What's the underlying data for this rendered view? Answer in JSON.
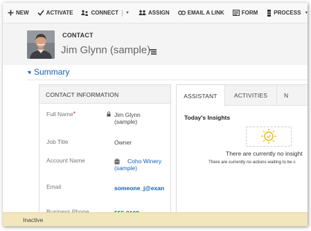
{
  "command_bar": {
    "new": "NEW",
    "activate": "ACTIVATE",
    "connect": "CONNECT",
    "assign": "ASSIGN",
    "email_link": "EMAIL A LINK",
    "form": "FORM",
    "process": "PROCESS"
  },
  "header": {
    "entity": "CONTACT",
    "record_name": "Jim Glynn (sample)"
  },
  "summary": {
    "title": "Summary"
  },
  "contact_info": {
    "heading": "CONTACT INFORMATION",
    "full_name_label": "Full Name",
    "full_name_line1": "Jim Glynn",
    "full_name_line2": "(sample)",
    "job_title_label": "Job Title",
    "job_title_value": "Owner",
    "account_label": "Account Name",
    "account_line1": "Coho Winery",
    "account_line2": "(sample)",
    "email_label": "Email",
    "email_value": "someone_j@exan",
    "phone_label": "Business Phone",
    "phone_value": "555-0109"
  },
  "tabs": {
    "assistant": "ASSISTANT",
    "activities": "ACTIVITIES",
    "third": "N"
  },
  "assistant": {
    "title": "Today's Insights",
    "empty_main": "There are currently no insight",
    "empty_sub": "There are currently no actions waiting to be c"
  },
  "status": {
    "text": "Inactive"
  },
  "colors": {
    "accent": "#1160b7",
    "status_bar": "#f2e6bd",
    "required": "#cc0000",
    "insight_icon": "#f0b90b"
  }
}
